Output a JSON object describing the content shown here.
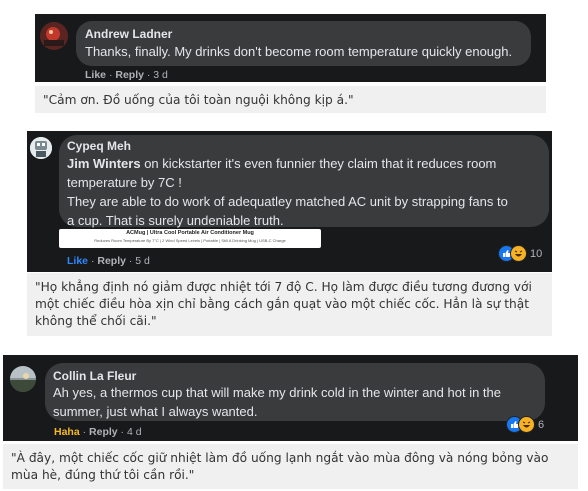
{
  "comments": [
    {
      "author": "Andrew Ladner",
      "lines": [
        "Thanks, finally. My drinks don't become room temperature quickly enough."
      ],
      "actions": {
        "like": "Like",
        "sep1": "·",
        "reply": "Reply",
        "time": "3 d"
      },
      "translation": "\"Cảm ơn. Đồ uống của tôi toàn nguội không kịp á.\""
    },
    {
      "author": "Cypeq Meh",
      "mention": "Jim Winters",
      "lines": [
        " on kickstarter it's even funnier they claim that it reduces room",
        "temperature by 7C !",
        "They are able to do work of adequatley matched AC unit by strapping fans to",
        "a cup. That is surely undeniable truth."
      ],
      "attachment": {
        "title": "ACMug | Ultra Cool Portable Air Conditioner Mug",
        "subtitle": "Reduces Room Temperature By 7°C | 2 Wind Speed Levels | Portable | Still A Drinking Mug | USB-C Charge"
      },
      "actions": {
        "like": "Like",
        "sep1": "·",
        "reply": "Reply",
        "time": "5 d"
      },
      "reactions": {
        "count": "10",
        "icons": [
          "like-reaction",
          "haha-reaction"
        ]
      },
      "translation": "\"Họ khẳng định nó giảm được nhiệt tới 7 độ C. Họ làm được điều tương đương với một chiếc điều hòa xịn chỉ bằng cách gắn quạt vào một chiếc cốc. Hẳn là sự thật không thể chối cãi.\""
    },
    {
      "author": "Collin La Fleur",
      "lines": [
        "Ah yes, a thermos cup that will make my drink cold in the winter and hot in the",
        "summer, just what I always wanted."
      ],
      "actions": {
        "like": "Haha",
        "sep1": "·",
        "reply": "Reply",
        "time": "4 d"
      },
      "reactions": {
        "count": "6",
        "icons": [
          "like-reaction",
          "haha-reaction"
        ]
      },
      "translation": "\"À đây, một chiếc cốc giữ nhiệt làm đồ uống lạnh ngắt vào mùa đông và nóng bỏng vào mùa hè, đúng thứ tôi cần rồi.\""
    }
  ],
  "colors": {
    "dark_bg": "#18191a",
    "bubble": "#3a3b3c",
    "like_active": "#2d88ff",
    "haha_active": "#f7b928",
    "caption_bg": "#f0f0f0"
  }
}
